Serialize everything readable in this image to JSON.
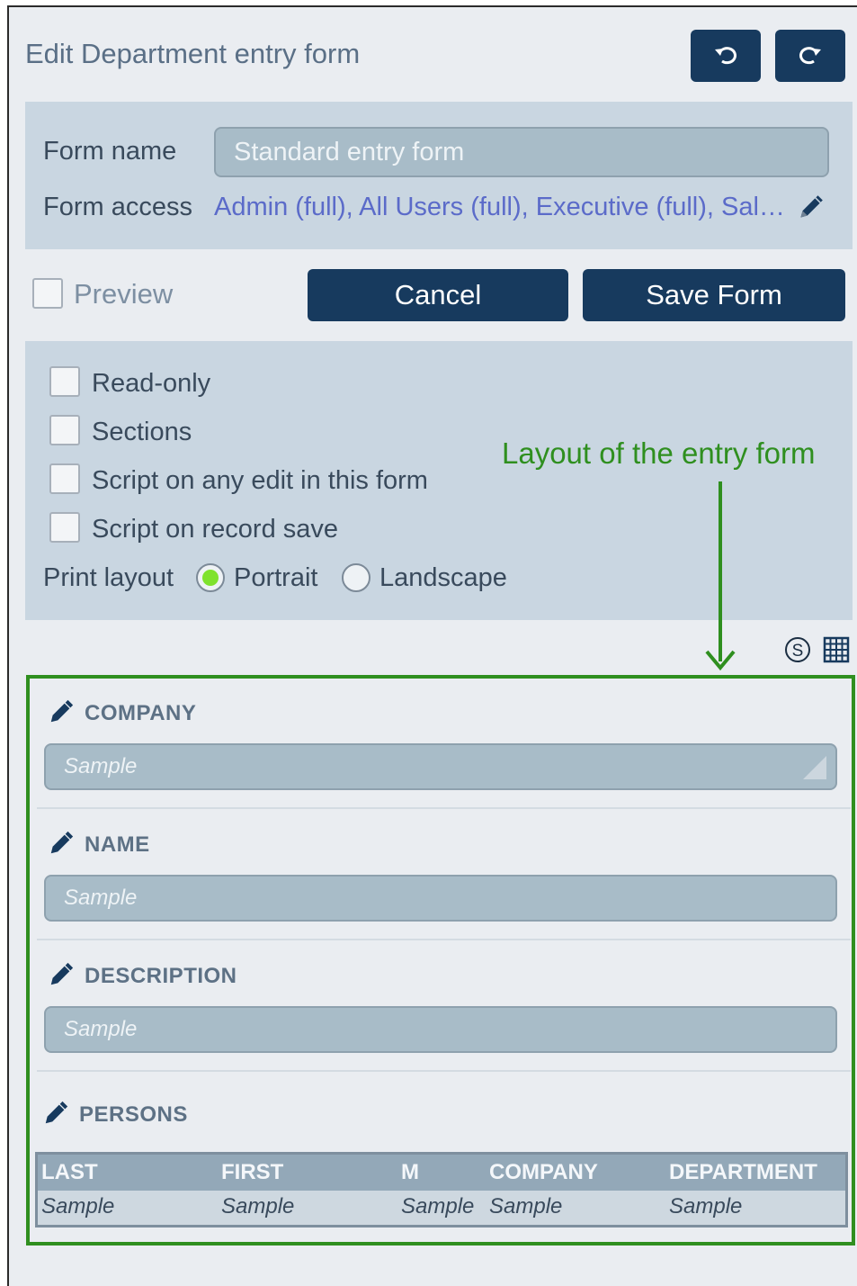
{
  "header": {
    "title": "Edit Department entry form",
    "undo_icon": "undo-icon",
    "redo_icon": "redo-icon"
  },
  "form_info": {
    "name_label": "Form name",
    "name_value": "Standard entry form",
    "access_label": "Form access",
    "access_value": "Admin (full), All Users (full), Executive (full), Sal…"
  },
  "actions": {
    "preview_label": "Preview",
    "cancel_label": "Cancel",
    "save_label": "Save Form"
  },
  "options": {
    "readonly_label": "Read-only",
    "sections_label": "Sections",
    "script_edit_label": "Script on any edit in this form",
    "script_save_label": "Script on record save",
    "print_layout_label": "Print layout",
    "portrait_label": "Portrait",
    "landscape_label": "Landscape",
    "selected_layout": "Portrait"
  },
  "annotation": {
    "text": "Layout of the entry form",
    "color": "#2f8f1f"
  },
  "layout": {
    "fields": [
      {
        "title": "COMPANY",
        "placeholder": "Sample",
        "type": "dropdown"
      },
      {
        "title": "NAME",
        "placeholder": "Sample",
        "type": "text"
      },
      {
        "title": "DESCRIPTION",
        "placeholder": "Sample",
        "type": "text"
      }
    ],
    "persons": {
      "title": "PERSONS",
      "columns": [
        "LAST",
        "FIRST",
        "M",
        "COMPANY",
        "DEPARTMENT"
      ],
      "row": [
        "Sample",
        "Sample",
        "Sample",
        "Sample",
        "Sample"
      ]
    }
  },
  "colors": {
    "accent": "#173a5e",
    "panel": "#c9d6e1",
    "link": "#5b6bc9",
    "radio_selected": "#7fe22d"
  }
}
